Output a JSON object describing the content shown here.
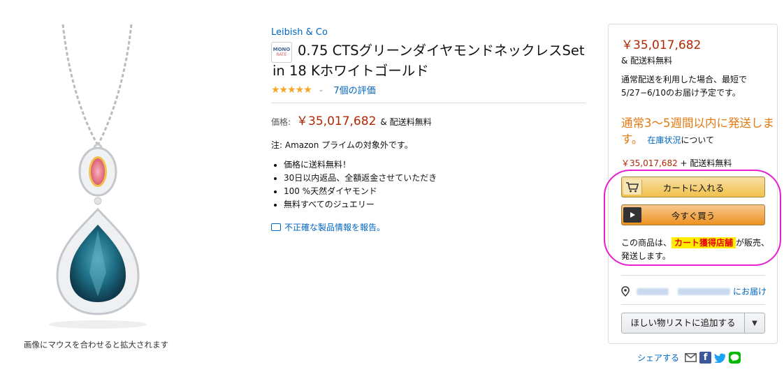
{
  "image": {
    "zoom_hint": "画像にマウスを合わせると拡大されます"
  },
  "product": {
    "brand": "Leibish & Co",
    "badge_top": "MONO",
    "badge_bottom": "RATE",
    "title_line1": "0.75 CTSグリーンダイヤモンドネックレスSet",
    "title_line2": "in 18 Kホワイトゴールド",
    "rating": 5,
    "rating_stars": "★★★★★",
    "reviews_link": "7個の評価",
    "price_label": "価格:",
    "price": "￥35,017,682",
    "price_shipping": "& 配送料無料",
    "prime_note": "注: Amazon プライムの対象外です。",
    "bullets": [
      "価格に送料無料！",
      "30日以内返品、全額返金させていただき",
      "100 %天然ダイヤモンド",
      "無料すべてのジュエリー"
    ],
    "report_link": "不正確な製品情報を報告。"
  },
  "buybox": {
    "price": "￥35,017,682",
    "shipping": "& 配送料無料",
    "delivery": "通常配送を利用した場合、最短で5/27−6/10のお届け予定です。",
    "stock_status": "通常3〜5週間以内に発送します。",
    "stock_link": "在庫状況",
    "stock_suffix": "について",
    "price2": "￥35,017,682",
    "price2_suffix": "+ 配送料無料",
    "cart_button": "カートに入れる",
    "buynow_button": "今すぐ買う",
    "seller_prefix": "この商品は、",
    "seller_tag": "カート獲得店舗",
    "seller_suffix": "が販売、発送します。",
    "deliver_to": "にお届け",
    "wishlist_button": "ほしい物リストに追加する"
  },
  "share": {
    "label": "シェアする"
  },
  "colors": {
    "price_red": "#b12704",
    "link_blue": "#0066c0",
    "stock_orange": "#e47911",
    "cart_yellow": "#f0c14b",
    "buynow_orange": "#ed9220",
    "highlight_magenta": "#e81fd0"
  }
}
